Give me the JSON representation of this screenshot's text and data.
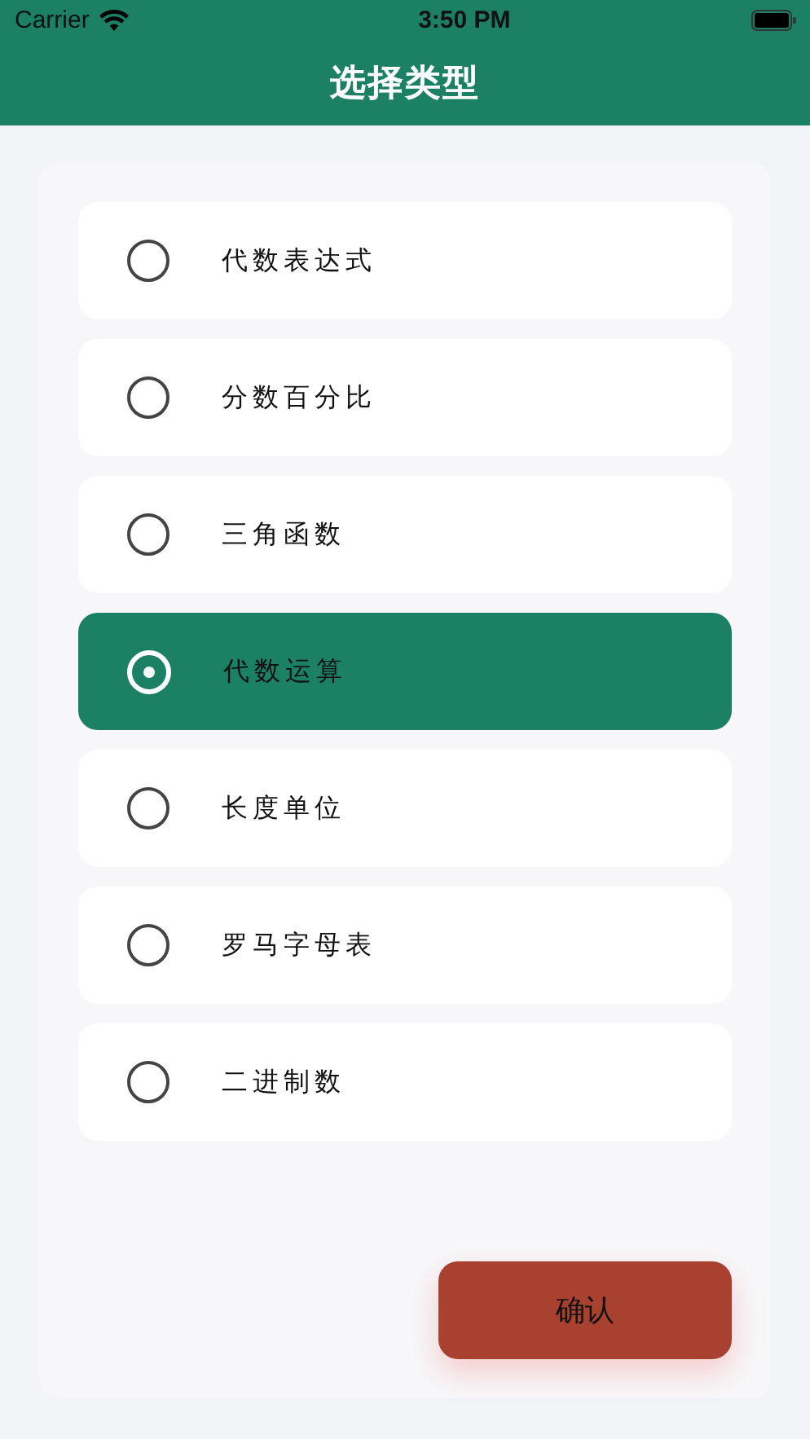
{
  "status_bar": {
    "carrier": "Carrier",
    "time": "3:50 PM"
  },
  "header": {
    "title": "选择类型"
  },
  "options": [
    {
      "label": "代数表达式",
      "selected": false
    },
    {
      "label": "分数百分比",
      "selected": false
    },
    {
      "label": "三角函数",
      "selected": false
    },
    {
      "label": "代数运算",
      "selected": true
    },
    {
      "label": "长度单位",
      "selected": false
    },
    {
      "label": "罗马字母表",
      "selected": false
    },
    {
      "label": "二进制数",
      "selected": false
    }
  ],
  "confirm_button": {
    "label": "确认"
  }
}
